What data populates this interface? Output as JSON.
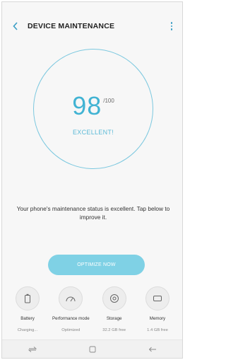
{
  "appbar": {
    "title": "DEVICE MAINTENANCE",
    "back_icon": "chevron-left-icon",
    "more_icon": "more-vert-icon"
  },
  "score": {
    "value": "98",
    "max": "/100",
    "label": "EXCELLENT!"
  },
  "status_message": "Your phone's maintenance status is excellent. Tap below to improve it.",
  "optimize_button": "OPTIMIZE NOW",
  "tiles": [
    {
      "icon": "battery-icon",
      "label": "Battery",
      "value": "Charging..."
    },
    {
      "icon": "gauge-icon",
      "label": "Performance mode",
      "value": "Optimized"
    },
    {
      "icon": "storage-disc-icon",
      "label": "Storage",
      "value": "32.2 GB free"
    },
    {
      "icon": "memory-chip-icon",
      "label": "Memory",
      "value": "1.4 GB free"
    }
  ],
  "navbar": {
    "recents_icon": "recents-icon",
    "home_icon": "home-icon",
    "back_icon": "back-arrow-icon"
  },
  "colors": {
    "accent": "#41b3d3",
    "ring": "#7cc8df",
    "button": "#7fd1e5",
    "background": "#f7f7f7"
  }
}
